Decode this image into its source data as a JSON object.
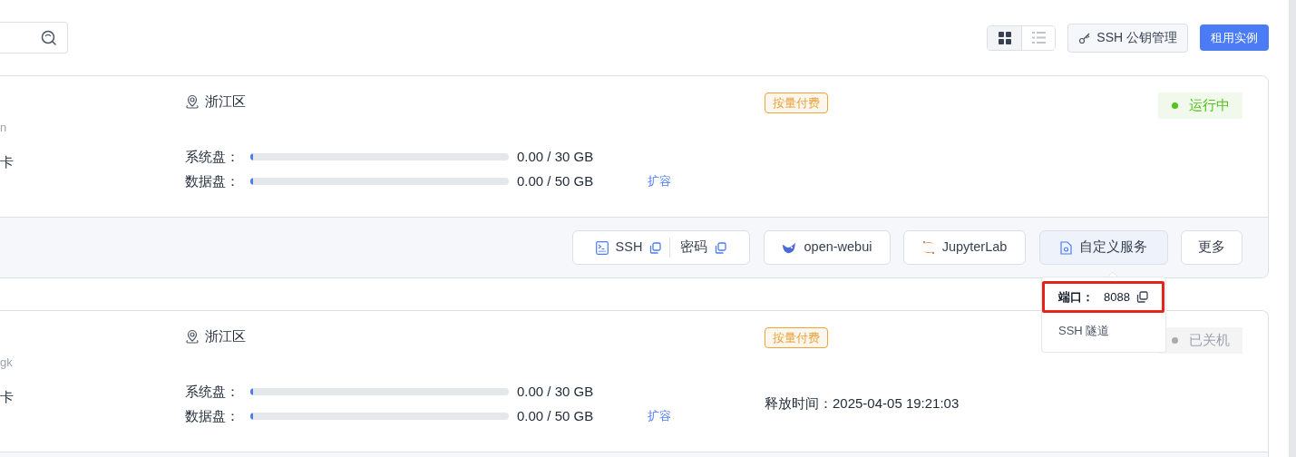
{
  "toolbar": {
    "view_toggle": [
      {
        "kind": "grid",
        "selected": true
      },
      {
        "kind": "list",
        "selected": false
      }
    ],
    "buttons": [
      {
        "kind": "ssh_keys",
        "label": "SSH 公钥管理"
      },
      {
        "kind": "rent",
        "label": "租用实例"
      }
    ]
  },
  "instances": [
    {
      "name_fragment": "n",
      "gpu_fragment": "卡",
      "region": "浙江区",
      "disks": [
        {
          "label": "系统盘：",
          "level": 0,
          "usage": "0.00 / 30 GB"
        },
        {
          "label": "数据盘：",
          "level": 0,
          "usage": "0.00 / 50 GB",
          "action": "扩容"
        }
      ],
      "billing": "按量付费",
      "status": {
        "kind": "running",
        "text": "运行中"
      },
      "actions": [
        {
          "kind": "ssh",
          "label": "SSH",
          "secondary": "密码",
          "active": false
        },
        {
          "kind": "webui",
          "label": "open-webui",
          "active": false
        },
        {
          "kind": "jupyter",
          "label": "JupyterLab",
          "active": false
        },
        {
          "kind": "custom",
          "label": "自定义服务",
          "active": true
        },
        {
          "kind": "more",
          "label": "更多",
          "active": false
        }
      ]
    },
    {
      "name_fragment": "gk",
      "gpu_fragment": "卡",
      "region": "浙江区",
      "disks": [
        {
          "label": "系统盘：",
          "level": 0,
          "usage": "0.00 / 30 GB"
        },
        {
          "label": "数据盘：",
          "level": 0,
          "usage": "0.00 / 50 GB",
          "action": "扩容"
        }
      ],
      "billing": "按量付费",
      "status": {
        "kind": "stopped",
        "text": "已关机"
      },
      "release_time": "释放时间：2025-04-05 19:21:03"
    }
  ],
  "popover": {
    "items": [
      {
        "kind": "port",
        "label": "端口：",
        "value": "8088",
        "highlighted": true
      },
      {
        "kind": "link",
        "label": "SSH 隧道",
        "highlighted": false
      }
    ]
  }
}
